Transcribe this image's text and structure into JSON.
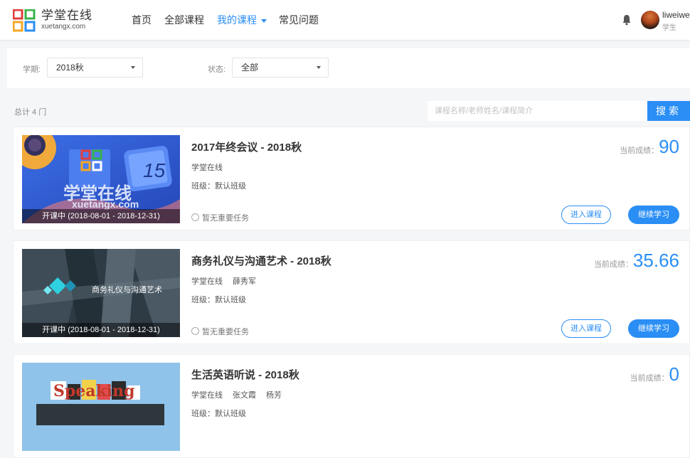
{
  "header": {
    "logo_cn": "学堂在线",
    "logo_en": "xuetangx.com",
    "nav": [
      "首页",
      "全部课程",
      "我的课程",
      "常见问题"
    ],
    "user_name": "liweiwe",
    "user_role": "学生"
  },
  "filters": {
    "term_label": "学期:",
    "term_value": "2018秋",
    "status_label": "状态:",
    "status_value": "全部"
  },
  "list": {
    "total": "总计 4 门",
    "search_placeholder": "课程名称/老师姓名/课程简介",
    "search_button": "搜索"
  },
  "courses": [
    {
      "title": "2017年终会议 - 2018秋",
      "school": "学堂在线",
      "teachers": [],
      "class": "班级：默认班级",
      "task": "暂无重要任务",
      "status": "开课中 (2018-08-01 - 2018-12-31)",
      "score_label": "当前成绩：",
      "score": "90",
      "enter": "进入课程",
      "continue": "继续学习",
      "thumb_text": "学堂在线",
      "thumb_sub": "xuetangx.com",
      "thumb_num": "15"
    },
    {
      "title": "商务礼仪与沟通艺术 - 2018秋",
      "school": "学堂在线",
      "teachers": [
        "薛秀军"
      ],
      "class": "班级：默认班级",
      "task": "暂无重要任务",
      "status": "开课中 (2018-08-01 - 2018-12-31)",
      "score_label": "当前成绩：",
      "score": "35.66",
      "enter": "进入课程",
      "continue": "继续学习",
      "thumb_text": "商务礼仪与沟通艺术"
    },
    {
      "title": "生活英语听说 - 2018秋",
      "school": "学堂在线",
      "teachers": [
        "张文霞",
        "杨芳"
      ],
      "class": "班级：默认班级",
      "score_label": "当前成绩：",
      "score": "0",
      "thumb_text": "Speaking"
    }
  ],
  "colors": {
    "accent": "#2a8ef5",
    "page_bg": "#f5f6f8"
  }
}
